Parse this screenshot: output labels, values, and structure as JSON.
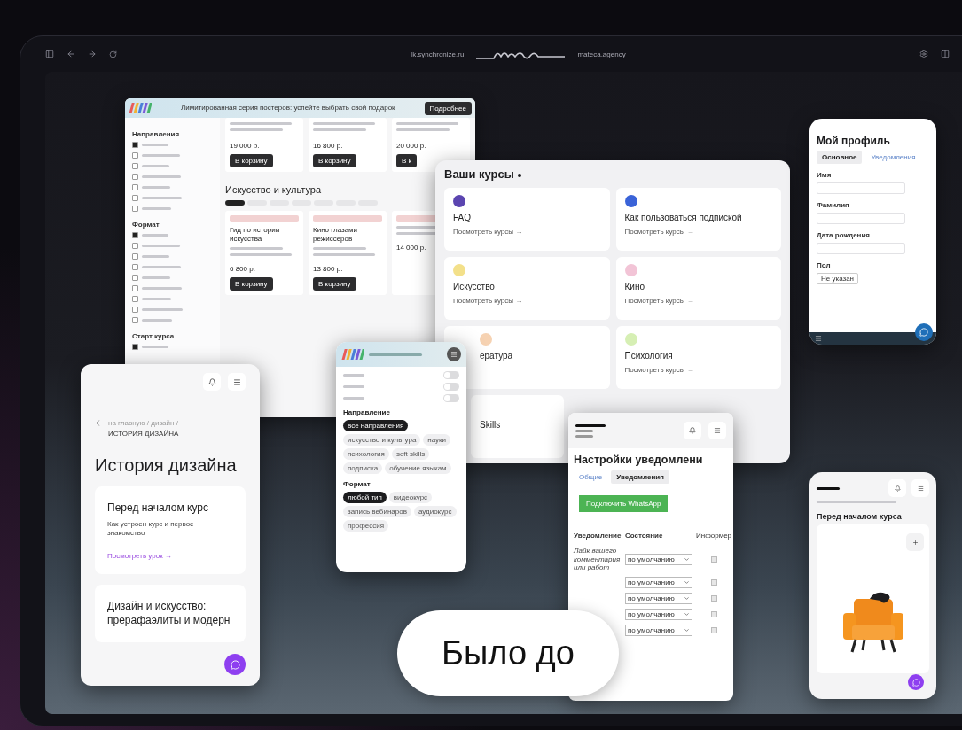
{
  "browser": {
    "address_left": "lk.synchronize.ru",
    "address_right": "mateca.agency"
  },
  "catalog": {
    "banner": {
      "text": "Лимитированная серия постеров: успейте выбрать свой подарок",
      "button": "Подробнее"
    },
    "sidebar": [
      {
        "heading": "Направления",
        "options": [
          {
            "checked": true
          },
          {
            "checked": false
          },
          {
            "checked": false
          },
          {
            "checked": false
          },
          {
            "checked": false
          },
          {
            "checked": false
          },
          {
            "checked": false
          }
        ]
      },
      {
        "heading": "Формат",
        "options": [
          {
            "checked": true
          },
          {
            "checked": false
          },
          {
            "checked": false
          },
          {
            "checked": false
          },
          {
            "checked": false
          },
          {
            "checked": false
          },
          {
            "checked": false
          },
          {
            "checked": false
          },
          {
            "checked": false
          }
        ]
      },
      {
        "heading": "Старт курса",
        "options": [
          {
            "checked": true
          }
        ]
      }
    ],
    "top_cards": [
      {
        "price": "19 000 р.",
        "button": "В корзину"
      },
      {
        "price": "16 800 р.",
        "button": "В корзину"
      },
      {
        "price": "20 000 р.",
        "button": "В к"
      }
    ],
    "section_title": "Искусство и культура",
    "chips": [
      {
        "selected": true
      },
      {
        "selected": false
      },
      {
        "selected": false
      },
      {
        "selected": false
      },
      {
        "selected": false
      },
      {
        "selected": false
      },
      {
        "selected": false
      }
    ],
    "cards": [
      {
        "title": "Гид по истории искусства",
        "price": "6 800 р.",
        "button": "В корзину"
      },
      {
        "title": "Кино глазами режиссёров",
        "price": "13 800 р.",
        "button": "В корзину"
      },
      {
        "price": "14 000 р."
      }
    ]
  },
  "courses": {
    "title": "Ваши курсы",
    "items": [
      {
        "kind": "full",
        "name": "FAQ",
        "link": "Посмотреть курсы →",
        "color": "#5b45b0"
      },
      {
        "kind": "full",
        "name": "Как пользоваться подпиской",
        "link": "Посмотреть курсы →",
        "color": "#3a63d8"
      },
      {
        "kind": "full",
        "name": "Искусство",
        "link": "Посмотреть курсы →",
        "color": "#f3e08a"
      },
      {
        "kind": "full",
        "name": "Кино",
        "link": "Посмотреть курсы →",
        "color": "#f2c4d6"
      },
      {
        "kind": "partial",
        "name": "ература",
        "color": "#f6d2b2"
      },
      {
        "kind": "full",
        "name": "Психология",
        "link": "Посмотреть курсы →",
        "color": "#d6efb4"
      },
      {
        "kind": "cut",
        "name": "Skills"
      }
    ]
  },
  "profile": {
    "title": "Мой профиль",
    "tabs": [
      {
        "label": "Основное",
        "selected": true
      },
      {
        "label": "Уведомления",
        "selected": false
      }
    ],
    "fields": [
      {
        "label": "Имя"
      },
      {
        "label": "Фамилия"
      },
      {
        "label": "Дата рождения"
      }
    ],
    "gender": {
      "label": "Пол",
      "value": "Не указан"
    }
  },
  "history": {
    "breadcrumb": "на главную / дизайн /",
    "current": "ИСТОРИЯ ДИЗАЙНА",
    "title": "История дизайна",
    "lessons": [
      {
        "title": "Перед началом курс",
        "subtitle": "Как устроен курс и первое знакомство",
        "link": "Посмотреть урок →"
      },
      {
        "title": "Дизайн и искусство: прерафаэлиты и модерн"
      }
    ]
  },
  "filter": {
    "toggles": [
      {
        "on": false
      },
      {
        "on": false
      },
      {
        "on": false
      }
    ],
    "groups": [
      {
        "title": "Направление",
        "chips": [
          {
            "label": "все направления",
            "selected": true
          },
          {
            "label": "искусство и культура",
            "selected": false
          },
          {
            "label": "науки",
            "selected": false
          },
          {
            "label": "психология",
            "selected": false
          },
          {
            "label": "soft skills",
            "selected": false
          },
          {
            "label": "подписка",
            "selected": false
          },
          {
            "label": "обучение языкам",
            "selected": false
          }
        ]
      },
      {
        "title": "Формат",
        "chips": [
          {
            "label": "любой тип",
            "selected": true
          },
          {
            "label": "видеокурс",
            "selected": false
          },
          {
            "label": "запись вебинаров",
            "selected": false
          },
          {
            "label": "аудиокурс",
            "selected": false
          },
          {
            "label": "профессия",
            "selected": false
          }
        ]
      }
    ]
  },
  "notifications": {
    "title": "Настройки уведомлени",
    "tabs": [
      {
        "label": "Общие",
        "selected": false
      },
      {
        "label": "Уведомления",
        "selected": true
      }
    ],
    "button": "Подключить WhatsApp",
    "columns": [
      "Уведомление",
      "Состояние",
      "Информер"
    ],
    "rows": [
      {
        "name": "Лайк вашего комментария или работ",
        "state": "по умолчанию",
        "checked": false
      },
      {
        "state": "по умолчанию",
        "checked": false
      },
      {
        "state": "по умолчанию",
        "checked": false
      },
      {
        "state": "по умолчанию",
        "checked": false
      },
      {
        "state": "по умолчанию",
        "checked": false
      }
    ]
  },
  "lesson_phone": {
    "title": "Перед началом курса"
  },
  "badge": {
    "text": "Было до"
  }
}
